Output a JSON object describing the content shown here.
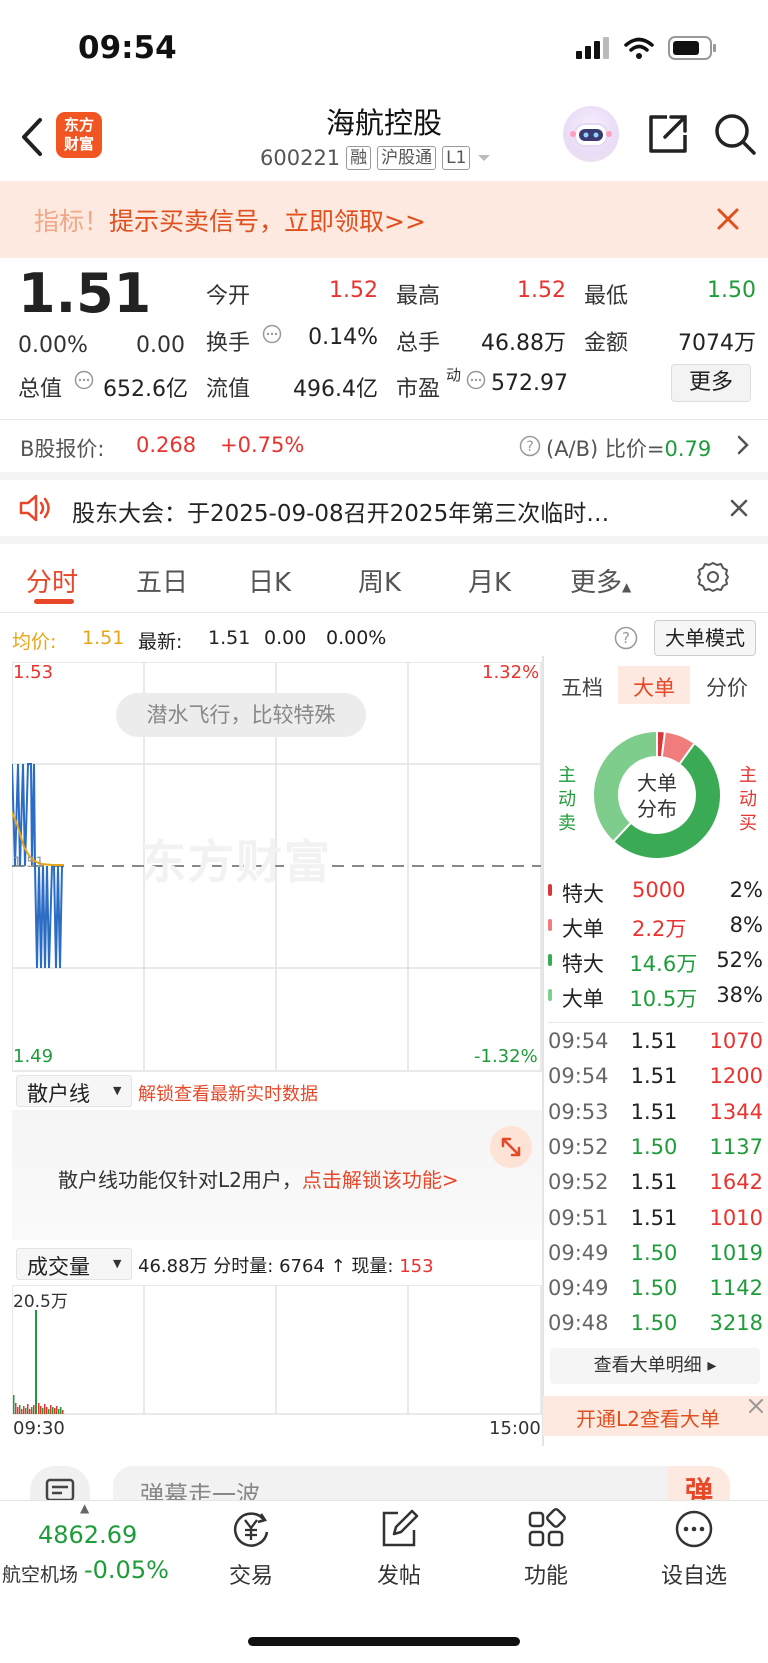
{
  "status": {
    "time": "09:54"
  },
  "header": {
    "title": "海航控股",
    "code": "600221",
    "tags": [
      "融",
      "沪股通",
      "L1"
    ],
    "logo": "东方\n财富"
  },
  "promo": {
    "lead": "指标！",
    "text": "提示买卖信号，立即领取>>"
  },
  "quote": {
    "price": "1.51",
    "change_pct": "0.00%",
    "change": "0.00",
    "open_label": "今开",
    "open": "1.52",
    "high_label": "最高",
    "high": "1.52",
    "low_label": "最低",
    "low": "1.50",
    "turnover_label": "换手",
    "turnover": "0.14%",
    "volume_label": "总手",
    "volume": "46.88万",
    "amount_label": "金额",
    "amount": "7074万",
    "mktcap_label": "总值",
    "mktcap": "652.6亿",
    "float_label": "流值",
    "float": "496.4亿",
    "pe_label": "市盈",
    "pe_sup": "动",
    "pe": "572.97",
    "more": "更多"
  },
  "bshare": {
    "label": "B股报价:",
    "price": "0.268",
    "change": "+0.75%",
    "ratio_label": "(A/B) 比价=",
    "ratio": "0.79"
  },
  "notice": {
    "text": "股东大会：于2025-09-08召开2025年第三次临时…"
  },
  "tabs": [
    "分时",
    "五日",
    "日K",
    "周K",
    "月K",
    "更多"
  ],
  "info_bar": {
    "avg_label": "均价:",
    "avg": "1.51",
    "latest_label": "最新:",
    "latest": "1.51",
    "chg": "0.00",
    "chg_pct": "0.00%",
    "mode": "大单模式"
  },
  "chart": {
    "y_top": "1.53",
    "y_mid": "1.51",
    "y_bottom": "1.49",
    "pct_top": "1.32%",
    "pct_bottom": "-1.32%",
    "bubble": "潜水飞行，比较特殊",
    "watermark": "东方财富"
  },
  "retail": {
    "selector": "散户线",
    "unlock_link": "解锁查看最新实时数据",
    "msg": "散户线功能仅针对L2用户，",
    "msg_link": "点击解锁该功能>"
  },
  "volume": {
    "selector": "成交量",
    "total": "46.88万",
    "minute_label": "分时量:",
    "minute": "6764",
    "now_label": "现量:",
    "now": "153",
    "y_top": "20.5万",
    "x_start": "09:30",
    "x_end": "15:00"
  },
  "right_panel": {
    "tabs": [
      "五档",
      "大单",
      "分价"
    ],
    "donut_center": [
      "大单",
      "分布"
    ],
    "buy_label": "主动买",
    "sell_label": "主动卖",
    "legend": [
      {
        "label": "特大",
        "value": "5000",
        "pct": "2%",
        "color": "#d9373a",
        "side": "buy"
      },
      {
        "label": "大单",
        "value": "2.2万",
        "pct": "8%",
        "color": "#f07c7c",
        "side": "buy"
      },
      {
        "label": "特大",
        "value": "14.6万",
        "pct": "52%",
        "color": "#3aaa55",
        "side": "sell"
      },
      {
        "label": "大单",
        "value": "10.5万",
        "pct": "38%",
        "color": "#7fcd8c",
        "side": "sell"
      }
    ],
    "trades": [
      {
        "time": "09:54",
        "price": "1.51",
        "vol": "1070",
        "color": "red"
      },
      {
        "time": "09:54",
        "price": "1.51",
        "vol": "1200",
        "color": "red"
      },
      {
        "time": "09:53",
        "price": "1.51",
        "vol": "1344",
        "color": "red"
      },
      {
        "time": "09:52",
        "price": "1.50",
        "vol": "1137",
        "color": "green"
      },
      {
        "time": "09:52",
        "price": "1.51",
        "vol": "1642",
        "color": "red"
      },
      {
        "time": "09:51",
        "price": "1.51",
        "vol": "1010",
        "color": "red"
      },
      {
        "time": "09:49",
        "price": "1.50",
        "vol": "1019",
        "color": "green"
      },
      {
        "time": "09:49",
        "price": "1.50",
        "vol": "1142",
        "color": "green"
      },
      {
        "time": "09:48",
        "price": "1.50",
        "vol": "3218",
        "color": "green"
      }
    ],
    "detail_btn": "查看大单明细 ▸",
    "l2_banner": "开通L2查看大单"
  },
  "comment": {
    "placeholder": "弹幕走一波...",
    "send": "弹"
  },
  "bottom": {
    "index_value": "4862.69",
    "index_name": "航空机场",
    "index_change": "-0.05%",
    "items": [
      "交易",
      "发帖",
      "功能",
      "设自选"
    ]
  }
}
